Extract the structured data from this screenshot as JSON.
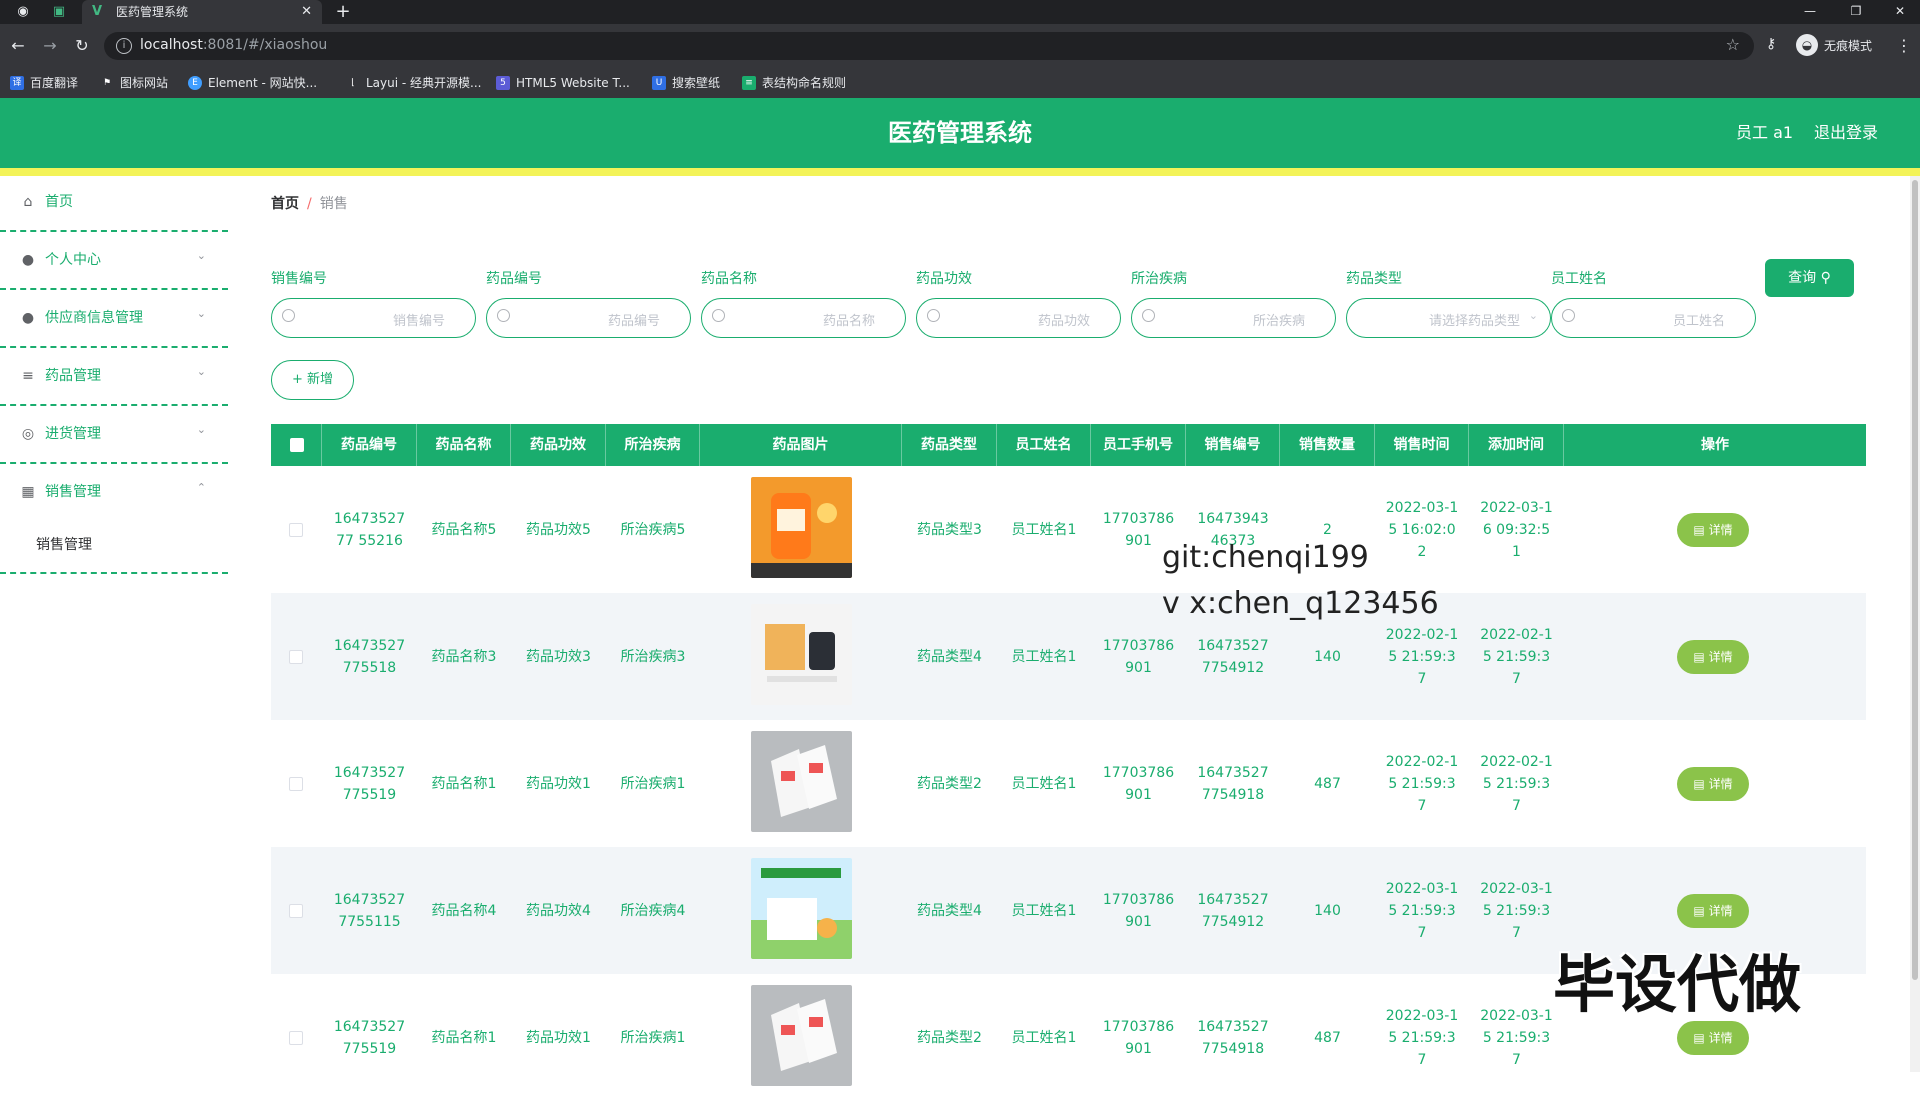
{
  "browser": {
    "tab_title": "医药管理系统",
    "url_host": "localhost",
    "url_path": ":8081/#/xiaoshou",
    "incognito_label": "无痕模式",
    "bookmarks": [
      "百度翻译",
      "图标网站",
      "Element - 网站快...",
      "Layui - 经典开源模...",
      "HTML5 Website T...",
      "搜索壁纸",
      "表结构命名规则"
    ]
  },
  "header": {
    "title": "医药管理系统",
    "user": "员工 a1",
    "logout": "退出登录",
    "colors": {
      "primary": "#1aad6e",
      "strip": "#f3f358"
    }
  },
  "sidebar": {
    "items": [
      {
        "label": "首页",
        "icon": "home-icon"
      },
      {
        "label": "个人中心",
        "icon": "user-icon"
      },
      {
        "label": "供应商信息管理",
        "icon": "user-icon"
      },
      {
        "label": "药品管理",
        "icon": "list-icon"
      },
      {
        "label": "进货管理",
        "icon": "compass-icon"
      },
      {
        "label": "销售管理",
        "icon": "store-icon"
      }
    ],
    "sub_item": "销售管理"
  },
  "breadcrumb": {
    "home": "首页",
    "separator": "/",
    "current": "销售"
  },
  "search": {
    "fields": [
      {
        "label": "销售编号",
        "placeholder": "销售编号"
      },
      {
        "label": "药品编号",
        "placeholder": "药品编号"
      },
      {
        "label": "药品名称",
        "placeholder": "药品名称"
      },
      {
        "label": "药品功效",
        "placeholder": "药品功效"
      },
      {
        "label": "所治疾病",
        "placeholder": "所治疾病"
      },
      {
        "label": "药品类型",
        "placeholder": "请选择药品类型"
      },
      {
        "label": "员工姓名",
        "placeholder": "员工姓名"
      }
    ],
    "query_label": "查询",
    "add_label": "+ 新增"
  },
  "table": {
    "headers": [
      "药品编号",
      "药品名称",
      "药品功效",
      "所治疾病",
      "药品图片",
      "药品类型",
      "员工姓名",
      "员工手机号",
      "销售编号",
      "销售数量",
      "销售时间",
      "添加时间",
      "操作"
    ],
    "detail_label": "详情",
    "rows": [
      {
        "drug_no": "1647352777 55216",
        "name": "药品名称5",
        "effect": "药品功效5",
        "disease": "所治疾病5",
        "type": "药品类型3",
        "staff": "员工姓名1",
        "phone": "17703786 901",
        "sale_no": "16473943 46373",
        "qty": "2",
        "sale_time": "2022-03-1 5 16:02:02",
        "add_time": "2022-03-1 6 09:32:51"
      },
      {
        "drug_no": "16473527 775518",
        "name": "药品名称3",
        "effect": "药品功效3",
        "disease": "所治疾病3",
        "type": "药品类型4",
        "staff": "员工姓名1",
        "phone": "17703786 901",
        "sale_no": "16473527 7754912",
        "qty": "140",
        "sale_time": "2022-02-1 5 21:59:37",
        "add_time": "2022-02-1 5 21:59:37"
      },
      {
        "drug_no": "16473527 775519",
        "name": "药品名称1",
        "effect": "药品功效1",
        "disease": "所治疾病1",
        "type": "药品类型2",
        "staff": "员工姓名1",
        "phone": "17703786 901",
        "sale_no": "16473527 7754918",
        "qty": "487",
        "sale_time": "2022-02-1 5 21:59:37",
        "add_time": "2022-02-1 5 21:59:37"
      },
      {
        "drug_no": "16473527 7755115",
        "name": "药品名称4",
        "effect": "药品功效4",
        "disease": "所治疾病4",
        "type": "药品类型4",
        "staff": "员工姓名1",
        "phone": "17703786 901",
        "sale_no": "16473527 7754912",
        "qty": "140",
        "sale_time": "2022-03-1 5 21:59:37",
        "add_time": "2022-03-1 5 21:59:37"
      },
      {
        "drug_no": "16473527 775519",
        "name": "药品名称1",
        "effect": "药品功效1",
        "disease": "所治疾病1",
        "type": "药品类型2",
        "staff": "员工姓名1",
        "phone": "17703786 901",
        "sale_no": "16473527 7754918",
        "qty": "487",
        "sale_time": "2022-03-1 5 21:59:37",
        "add_time": "2022-03-1 5 21:59:37"
      }
    ]
  },
  "watermarks": {
    "git": "git:chenqi199",
    "wechat": "v x:chen_q123456",
    "ad": "毕设代做"
  }
}
